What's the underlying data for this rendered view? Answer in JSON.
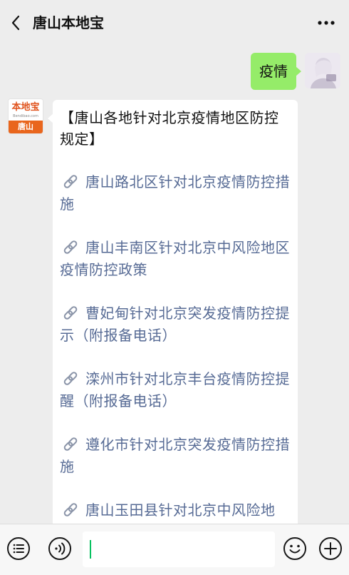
{
  "header": {
    "title": "唐山本地宝"
  },
  "chat": {
    "user_message": "疫情",
    "bot": {
      "avatar_logo_main": "本地宝",
      "avatar_logo_sub": "Bendibao.com",
      "avatar_logo_city": "唐山",
      "title": "【唐山各地针对北京疫情地区防控规定】",
      "links": [
        "唐山路北区针对北京疫情防控措施",
        "唐山丰南区针对北京中风险地区疫情防控政策",
        "曹妃甸针对北京突发疫情防控提示（附报备电话）",
        "滦州市针对北京丰台疫情防控提醒（附报备电话）",
        "遵化市针对北京突发疫情防控措施",
        "唐山玉田县针对北京中风险地"
      ]
    }
  },
  "input": {
    "value": ""
  },
  "colors": {
    "background": "#ededed",
    "user_bubble": "#95ec69",
    "link": "#576b95",
    "accent": "#07c160",
    "logo_orange": "#e9661d"
  },
  "icons": {
    "back": "chevron-left-icon",
    "more": "more-dots-icon",
    "menu": "list-menu-icon",
    "voice": "voice-icon",
    "emoji": "emoji-icon",
    "add": "plus-circle-icon",
    "link": "link-icon"
  }
}
